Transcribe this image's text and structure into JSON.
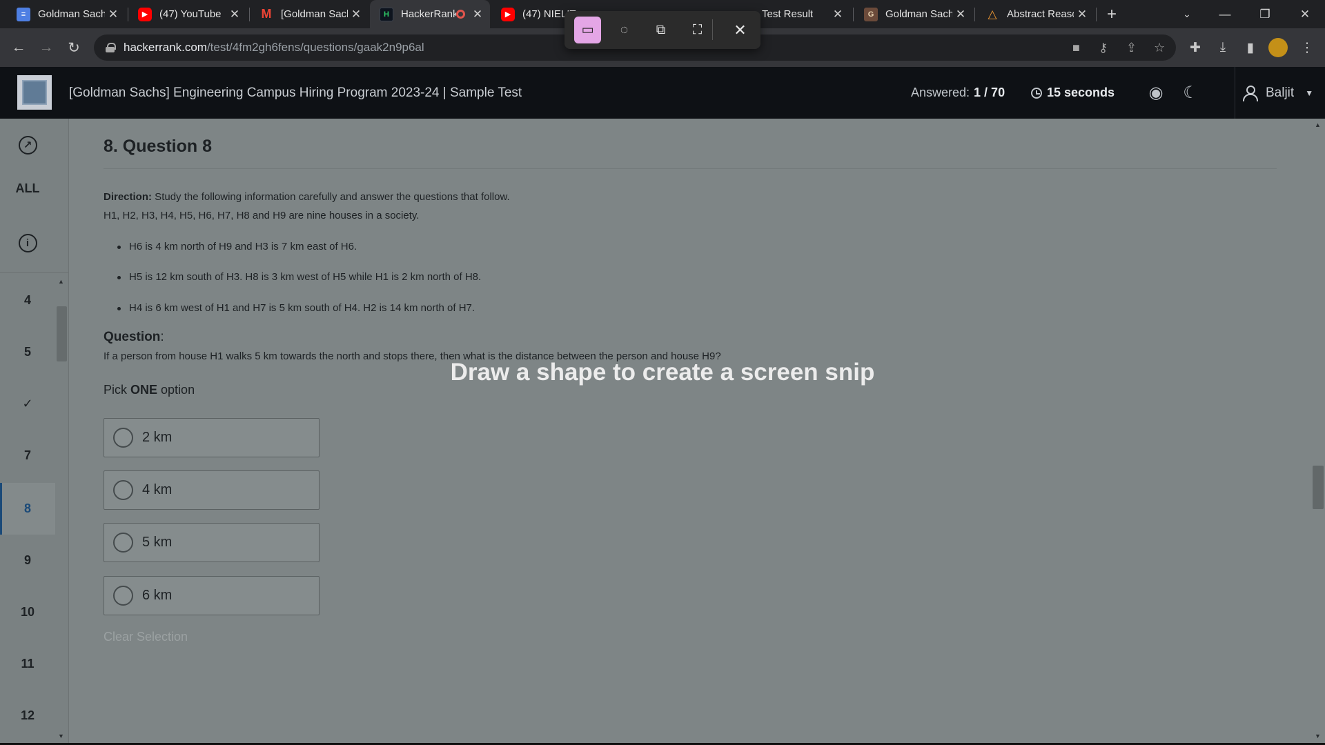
{
  "browser": {
    "tabs": [
      {
        "title": "Goldman Sachs",
        "icon": "google-docs-icon"
      },
      {
        "title": "(47) YouTube",
        "icon": "youtube-icon"
      },
      {
        "title": "[Goldman Sachs",
        "icon": "gmail-icon"
      },
      {
        "title": "HackerRank",
        "icon": "hackerrank-icon"
      },
      {
        "title": "(47) NIELIT",
        "icon": "youtube-icon"
      },
      {
        "title": "Test Result",
        "icon": ""
      },
      {
        "title": "Goldman Sachs",
        "icon": "goldman-sachs-icon"
      },
      {
        "title": "Abstract Reasoning",
        "icon": "abstract-icon"
      }
    ],
    "url_host": "hackerrank.com",
    "url_path": "/test/4fm2gh6fens/questions/gaak2n9p6al"
  },
  "snip_message": "Draw a shape to create a screen snip",
  "header": {
    "test_title": "[Goldman Sachs] Engineering Campus Hiring Program 2023-24 | Sample Test",
    "answered_label": "Answered:",
    "answered_value": "1 / 70",
    "timer": "15 seconds",
    "user_name": "Baljit"
  },
  "sidebar": {
    "all_label": "ALL",
    "items": [
      "4",
      "5",
      "✓",
      "7",
      "8",
      "9",
      "10",
      "11",
      "12"
    ],
    "active": "8"
  },
  "question": {
    "heading": "8. Question 8",
    "direction_label": "Direction:",
    "direction_text": " Study the following information carefully and answer the questions that follow.",
    "intro": "H1, H2, H3, H4, H5, H6, H7, H8 and H9 are nine houses in a society.",
    "bullets": [
      "H6 is 4 km north of H9 and H3 is 7 km east of H6.",
      "H5 is 12 km south of H3. H8 is 3 km west of H5 while H1 is 2 km north of H8.",
      "H4 is 6 km west of H1 and H7 is 5 km south of H4. H2 is 14 km north of H7."
    ],
    "question_label": "Question",
    "question_text": "If a person from house H1 walks 5 km towards the north and stops there, then what is the distance between the person and house H9?",
    "pick_prefix": "Pick ",
    "pick_bold": "ONE",
    "pick_suffix": " option",
    "options": [
      "2 km",
      "4 km",
      "5 km",
      "6 km"
    ],
    "clear_label": "Clear Selection"
  }
}
